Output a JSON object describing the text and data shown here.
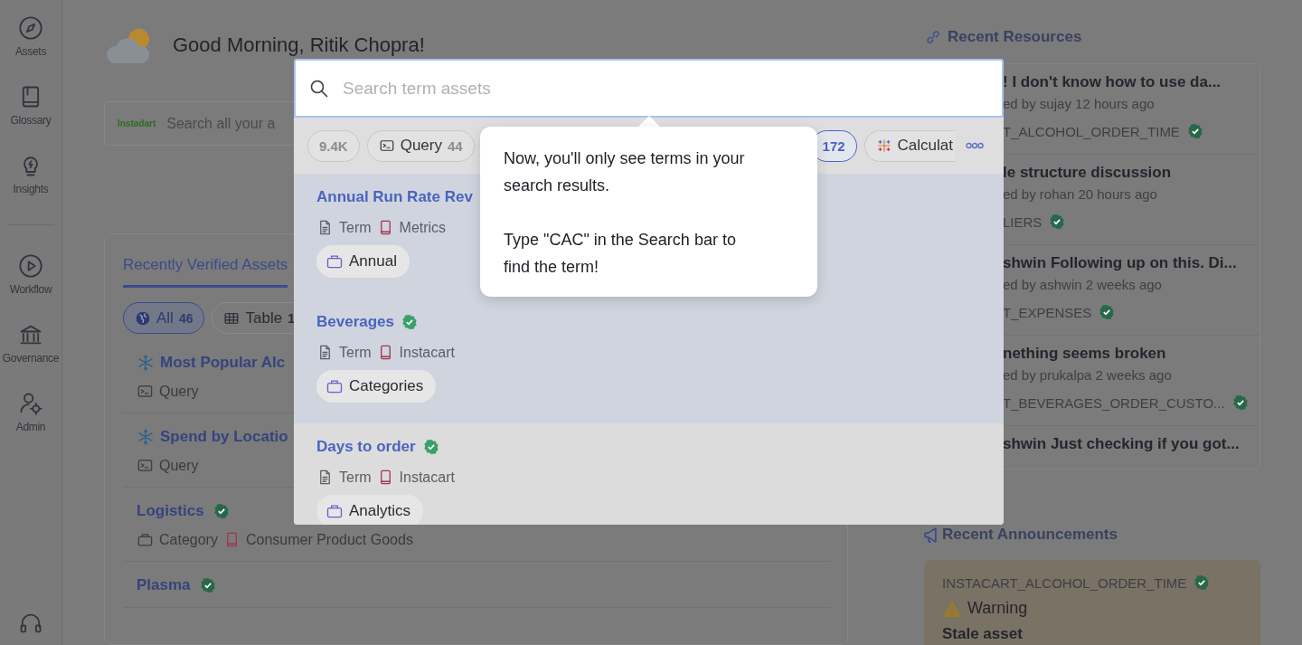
{
  "sidebar": {
    "items": [
      {
        "label": "Assets"
      },
      {
        "label": "Glossary"
      },
      {
        "label": "Insights"
      },
      {
        "label": "Workflow"
      },
      {
        "label": "Governance"
      },
      {
        "label": "Admin"
      }
    ]
  },
  "greeting": "Good Morning, Ritik Chopra!",
  "search": {
    "logo": "Instadart",
    "placeholder": "Search all your a"
  },
  "verified_panel": {
    "tabs": [
      {
        "label": "Recently Verified Assets",
        "selected": true
      }
    ],
    "filters": [
      {
        "kind": "all",
        "label": "All",
        "count": "46",
        "selected": true
      },
      {
        "kind": "table",
        "label": "Table",
        "count": "1",
        "selected": false
      }
    ],
    "assets": [
      {
        "kind": "query",
        "title": "Most Popular Alc",
        "meta": [
          {
            "kind": "query",
            "text": "Query"
          }
        ]
      },
      {
        "kind": "query",
        "title": "Spend by Locatio",
        "meta": [
          {
            "kind": "query",
            "text": "Query"
          }
        ]
      },
      {
        "kind": "category",
        "title": "Logistics",
        "verified": true,
        "meta": [
          {
            "kind": "category",
            "text": "Category"
          },
          {
            "kind": "glossary",
            "text": "Consumer Product Goods"
          }
        ]
      },
      {
        "kind": "term",
        "title": "Plasma",
        "verified": true
      }
    ]
  },
  "modal": {
    "placeholder": "Search term assets",
    "filters": [
      {
        "kind": "plain",
        "count": "9.4K",
        "selected": false
      },
      {
        "kind": "query",
        "label": "Query",
        "count": "44",
        "selected": false
      },
      {
        "kind": "plain",
        "count": "172",
        "selected": true
      },
      {
        "kind": "tableau",
        "label": "Calculat",
        "selected": false
      }
    ],
    "results": [
      {
        "title": "Annual Run Rate Rev",
        "highlighted": true,
        "meta": [
          {
            "kind": "term",
            "text": "Term"
          },
          {
            "kind": "glossary",
            "text": "Metrics"
          }
        ],
        "tags": [
          "Annual"
        ]
      },
      {
        "title": "Beverages",
        "verified": true,
        "highlighted": true,
        "meta": [
          {
            "kind": "term",
            "text": "Term"
          },
          {
            "kind": "glossary",
            "text": "Instacart"
          }
        ],
        "tags": [
          "Categories"
        ]
      },
      {
        "title": "Days to order",
        "verified": true,
        "highlighted": false,
        "meta": [
          {
            "kind": "term",
            "text": "Term"
          },
          {
            "kind": "glossary",
            "text": "Instacart"
          }
        ],
        "tags": [
          "Analytics"
        ]
      }
    ]
  },
  "tooltip": {
    "paragraphs": [
      "Now, you'll only see terms in your search results.",
      "Type \"CAC\" in the Search bar to find the term!"
    ]
  },
  "recent_resources": {
    "title": "Recent Resources",
    "items": [
      {
        "title": "! I don't know how to use da...",
        "subtitle": "ed by sujay 12 hours ago",
        "asset": "T_ALCOHOL_ORDER_TIME",
        "verified": true
      },
      {
        "title": "le structure discussion",
        "subtitle": "ed by rohan 20 hours ago",
        "asset": "LIERS",
        "verified": true
      },
      {
        "title": "shwin Following up on this. Di...",
        "subtitle": "ed by ashwin 2 weeks ago",
        "asset": "T_EXPENSES",
        "verified": true
      },
      {
        "title": "nething seems broken",
        "subtitle": "ed by prukalpa 2 weeks ago",
        "asset": "T_BEVERAGES_ORDER_CUSTO...",
        "verified": true
      },
      {
        "title": "shwin Just checking if you got..."
      }
    ]
  },
  "announcements": {
    "title": "Recent Announcements",
    "items": [
      {
        "kind": "warning",
        "asset": "INSTACART_ALCOHOL_ORDER_TIME",
        "verified": true,
        "status": "Warning",
        "message": "Stale asset"
      }
    ]
  }
}
